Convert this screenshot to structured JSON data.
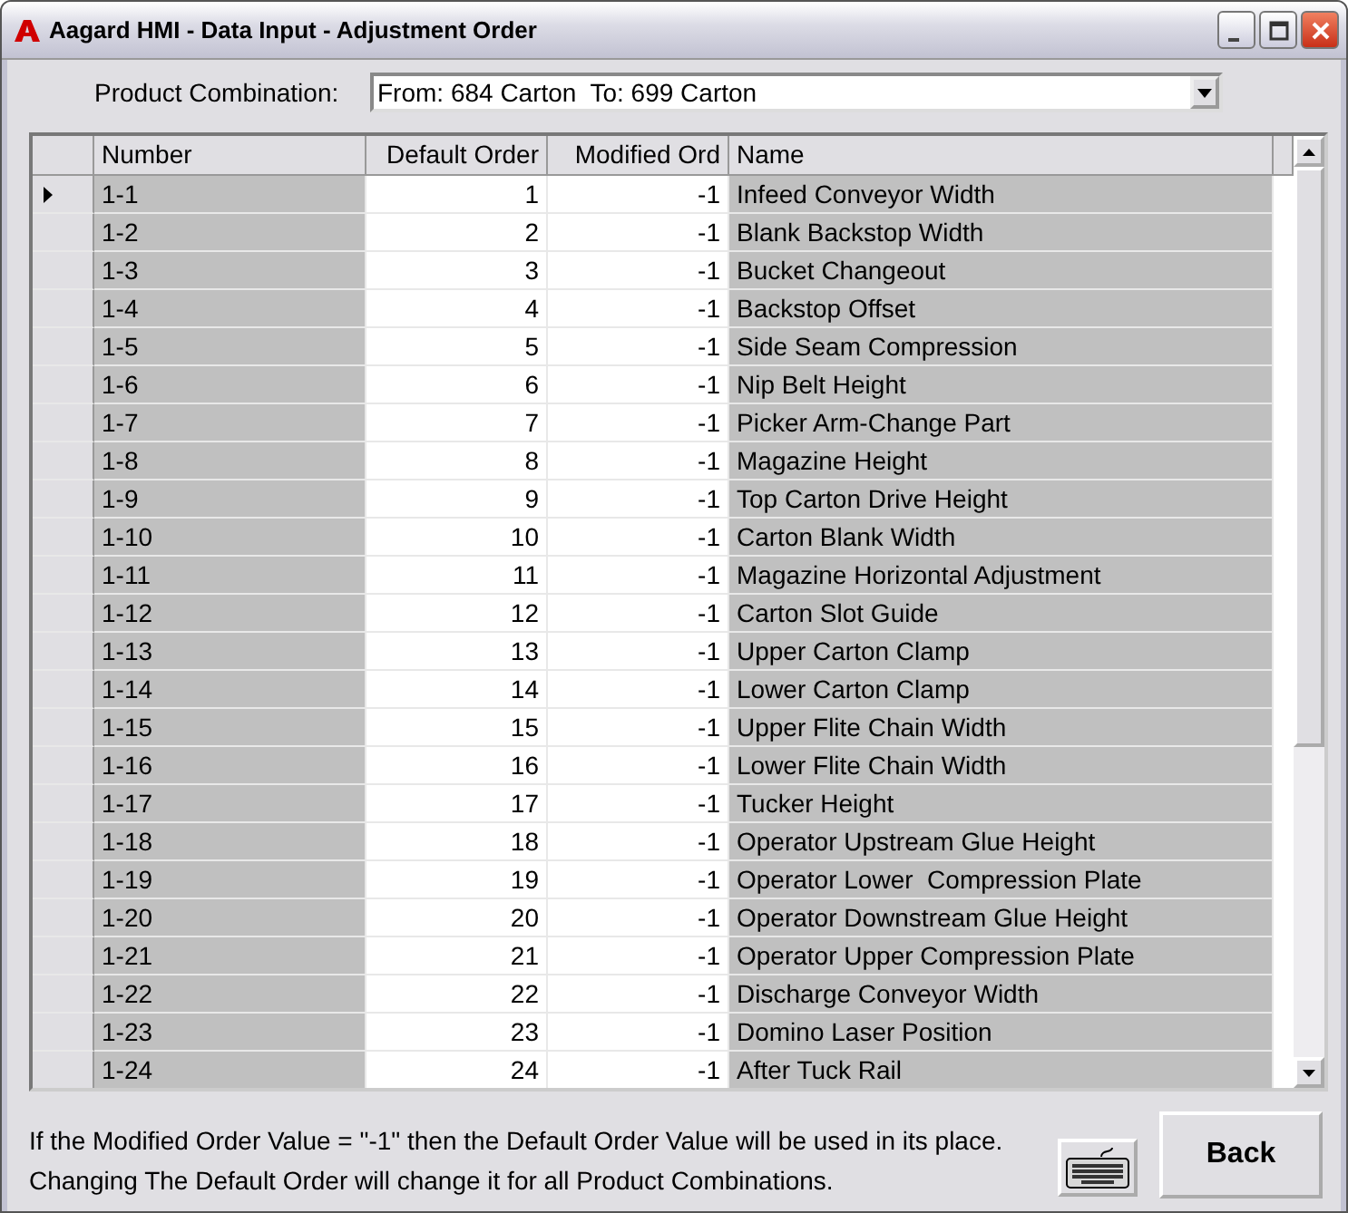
{
  "window": {
    "title": "Aagard HMI - Data Input - Adjustment Order"
  },
  "product_combination": {
    "label": "Product Combination:",
    "value": "From: 684 Carton  To: 699 Carton"
  },
  "table": {
    "columns": [
      "Number",
      "Default Order",
      "Modified Ord",
      "Name"
    ],
    "rows": [
      {
        "number": "1-1",
        "default_order": "1",
        "modified_order": "-1",
        "name": "Infeed Conveyor Width",
        "selected": true
      },
      {
        "number": "1-2",
        "default_order": "2",
        "modified_order": "-1",
        "name": "Blank Backstop Width",
        "selected": false
      },
      {
        "number": "1-3",
        "default_order": "3",
        "modified_order": "-1",
        "name": "Bucket Changeout",
        "selected": false
      },
      {
        "number": "1-4",
        "default_order": "4",
        "modified_order": "-1",
        "name": "Backstop Offset",
        "selected": false
      },
      {
        "number": "1-5",
        "default_order": "5",
        "modified_order": "-1",
        "name": "Side Seam Compression",
        "selected": false
      },
      {
        "number": "1-6",
        "default_order": "6",
        "modified_order": "-1",
        "name": "Nip Belt Height",
        "selected": false
      },
      {
        "number": "1-7",
        "default_order": "7",
        "modified_order": "-1",
        "name": "Picker Arm-Change Part",
        "selected": false
      },
      {
        "number": "1-8",
        "default_order": "8",
        "modified_order": "-1",
        "name": "Magazine Height",
        "selected": false
      },
      {
        "number": "1-9",
        "default_order": "9",
        "modified_order": "-1",
        "name": "Top Carton Drive Height",
        "selected": false
      },
      {
        "number": "1-10",
        "default_order": "10",
        "modified_order": "-1",
        "name": "Carton Blank Width",
        "selected": false
      },
      {
        "number": "1-11",
        "default_order": "11",
        "modified_order": "-1",
        "name": "Magazine Horizontal Adjustment",
        "selected": false
      },
      {
        "number": "1-12",
        "default_order": "12",
        "modified_order": "-1",
        "name": "Carton Slot Guide",
        "selected": false
      },
      {
        "number": "1-13",
        "default_order": "13",
        "modified_order": "-1",
        "name": "Upper Carton Clamp",
        "selected": false
      },
      {
        "number": "1-14",
        "default_order": "14",
        "modified_order": "-1",
        "name": "Lower Carton Clamp",
        "selected": false
      },
      {
        "number": "1-15",
        "default_order": "15",
        "modified_order": "-1",
        "name": "Upper Flite Chain Width",
        "selected": false
      },
      {
        "number": "1-16",
        "default_order": "16",
        "modified_order": "-1",
        "name": "Lower Flite Chain Width",
        "selected": false
      },
      {
        "number": "1-17",
        "default_order": "17",
        "modified_order": "-1",
        "name": "Tucker Height",
        "selected": false
      },
      {
        "number": "1-18",
        "default_order": "18",
        "modified_order": "-1",
        "name": "Operator Upstream Glue Height",
        "selected": false
      },
      {
        "number": "1-19",
        "default_order": "19",
        "modified_order": "-1",
        "name": "Operator Lower  Compression Plate",
        "selected": false
      },
      {
        "number": "1-20",
        "default_order": "20",
        "modified_order": "-1",
        "name": "Operator Downstream Glue Height",
        "selected": false
      },
      {
        "number": "1-21",
        "default_order": "21",
        "modified_order": "-1",
        "name": "Operator Upper Compression Plate",
        "selected": false
      },
      {
        "number": "1-22",
        "default_order": "22",
        "modified_order": "-1",
        "name": "Discharge Conveyor Width",
        "selected": false
      },
      {
        "number": "1-23",
        "default_order": "23",
        "modified_order": "-1",
        "name": "Domino Laser Position",
        "selected": false
      },
      {
        "number": "1-24",
        "default_order": "24",
        "modified_order": "-1",
        "name": "After Tuck Rail",
        "selected": false
      }
    ]
  },
  "notes": [
    "If the Modified Order Value = \"-1\" then the Default Order Value will be used in its place.",
    "Changing The Default Order will change it for all Product Combinations."
  ],
  "buttons": {
    "back": "Back"
  }
}
